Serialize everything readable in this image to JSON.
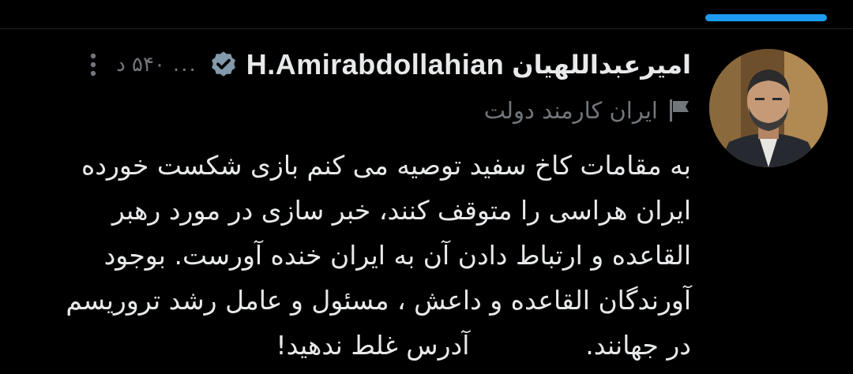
{
  "tweet": {
    "author_name_fa": "امیرعبداللهیان",
    "author_name_en": "H.Amirabdollahian",
    "ellipsis": "...",
    "timestamp": "۵۴۰ د",
    "account_label": "ایران کارمند دولت",
    "body_lines": [
      "به مقامات کاخ سفید توصیه می کنم بازی شکست خورده",
      "ایران هراسی را متوقف کنند، خبر سازی در مورد رهبر",
      "القاعده و ارتباط دادن آن به ایران خنده آورست. بوجود",
      "آورندگان القاعده و داعش ، مسئول و عامل رشد تروریسم",
      "در جهانند.              آدرس غلط ندهید!"
    ]
  },
  "colors": {
    "background": "#000000",
    "text_primary": "#e7e9ea",
    "text_secondary": "#71767b",
    "accent": "#1d9bf0"
  },
  "icons": {
    "verified": "verified-badge-icon",
    "more": "more-vertical-icon",
    "flag": "flag-icon"
  }
}
